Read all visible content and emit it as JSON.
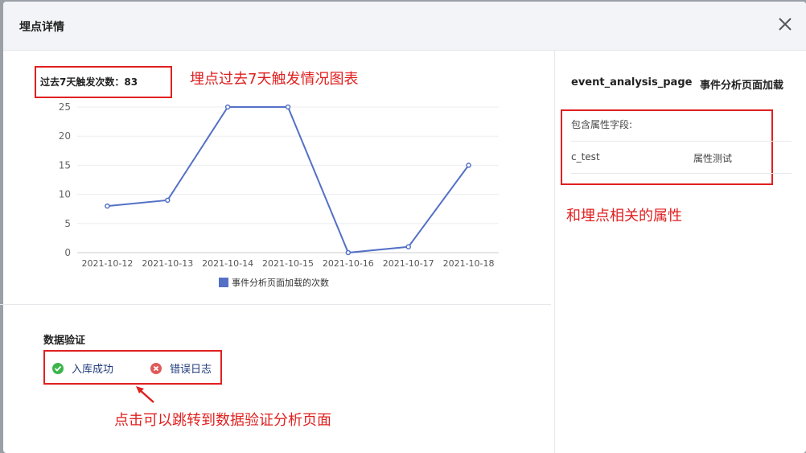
{
  "modal": {
    "title": "埋点详情"
  },
  "chart_header": {
    "trigger_count": "过去7天触发次数：83"
  },
  "chart_data": {
    "type": "line",
    "categories": [
      "2021-10-12",
      "2021-10-13",
      "2021-10-14",
      "2021-10-15",
      "2021-10-16",
      "2021-10-17",
      "2021-10-18"
    ],
    "series": [
      {
        "name": "事件分析页面加载的次数",
        "values": [
          8,
          9,
          25,
          25,
          0,
          1,
          15
        ]
      }
    ],
    "ylim": [
      0,
      25
    ],
    "yticks": [
      "0",
      "5",
      "10",
      "15",
      "20",
      "25"
    ],
    "grid": true,
    "legend_position": "bottom",
    "color": "#5470c6"
  },
  "validation": {
    "title": "数据验证",
    "success_label": "入库成功",
    "error_label": "错误日志"
  },
  "event": {
    "name": "event_analysis_page",
    "desc": "事件分析页面加载",
    "props_label": "包含属性字段:",
    "props": [
      {
        "key": "c_test",
        "value": "属性测试"
      }
    ]
  },
  "annotations": {
    "chart_note": "埋点过去7天触发情况图表",
    "props_note": "和埋点相关的属性",
    "validation_note": "点击可以跳转到数据验证分析页面"
  },
  "colors": {
    "accent": "#5470c6",
    "annotation": "#e02020",
    "success": "#3bb54a",
    "error": "#e05a5a"
  }
}
